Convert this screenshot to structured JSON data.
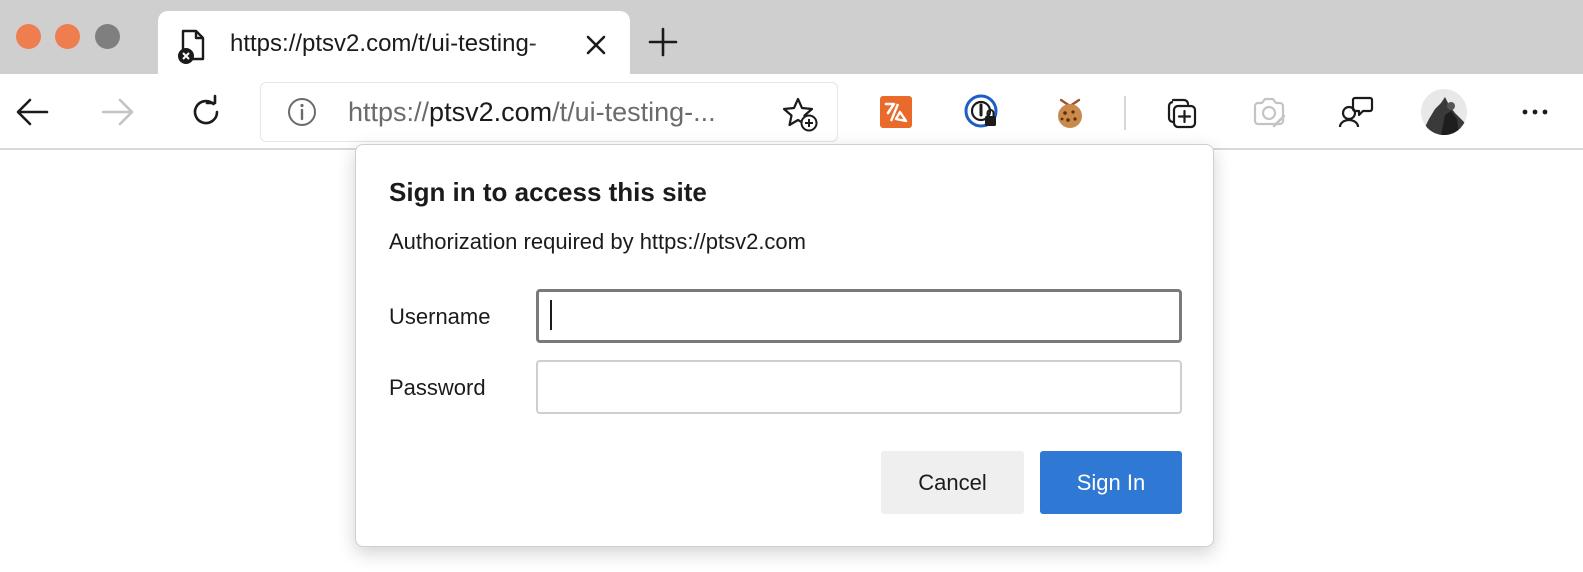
{
  "window": {
    "traffic_colors": {
      "close": "#ee7d4f",
      "minimize": "#ee7d4f",
      "zoom": "#7f7f7f"
    }
  },
  "tab": {
    "title": "https://ptsv2.com/t/ui-testing-",
    "favicon_icon": "page-error-icon",
    "close_icon": "close-icon"
  },
  "new_tab_icon": "plus-icon",
  "toolbar": {
    "back_icon": "arrow-left-icon",
    "forward_icon": "arrow-right-icon",
    "refresh_icon": "refresh-icon",
    "address": {
      "info_icon": "info-icon",
      "url_prefix": "https://",
      "url_host": "ptsv2.com",
      "url_path": "/t/ui-testing-...",
      "favorite_icon": "star-add-icon"
    },
    "extensions": [
      "translate-extension-icon",
      "password-manager-extension-icon",
      "cookie-extension-icon"
    ],
    "collections_icon": "collections-icon",
    "screenshot_icon": "camera-icon",
    "feedback_icon": "feedback-icon",
    "profile_icon": "avatar",
    "menu_icon": "more-icon"
  },
  "dialog": {
    "title": "Sign in to access this site",
    "subtitle": "Authorization required by https://ptsv2.com",
    "username_label": "Username",
    "username_value": "",
    "password_label": "Password",
    "password_value": "",
    "cancel_label": "Cancel",
    "signin_label": "Sign In",
    "accent_color": "#2f78d3"
  }
}
